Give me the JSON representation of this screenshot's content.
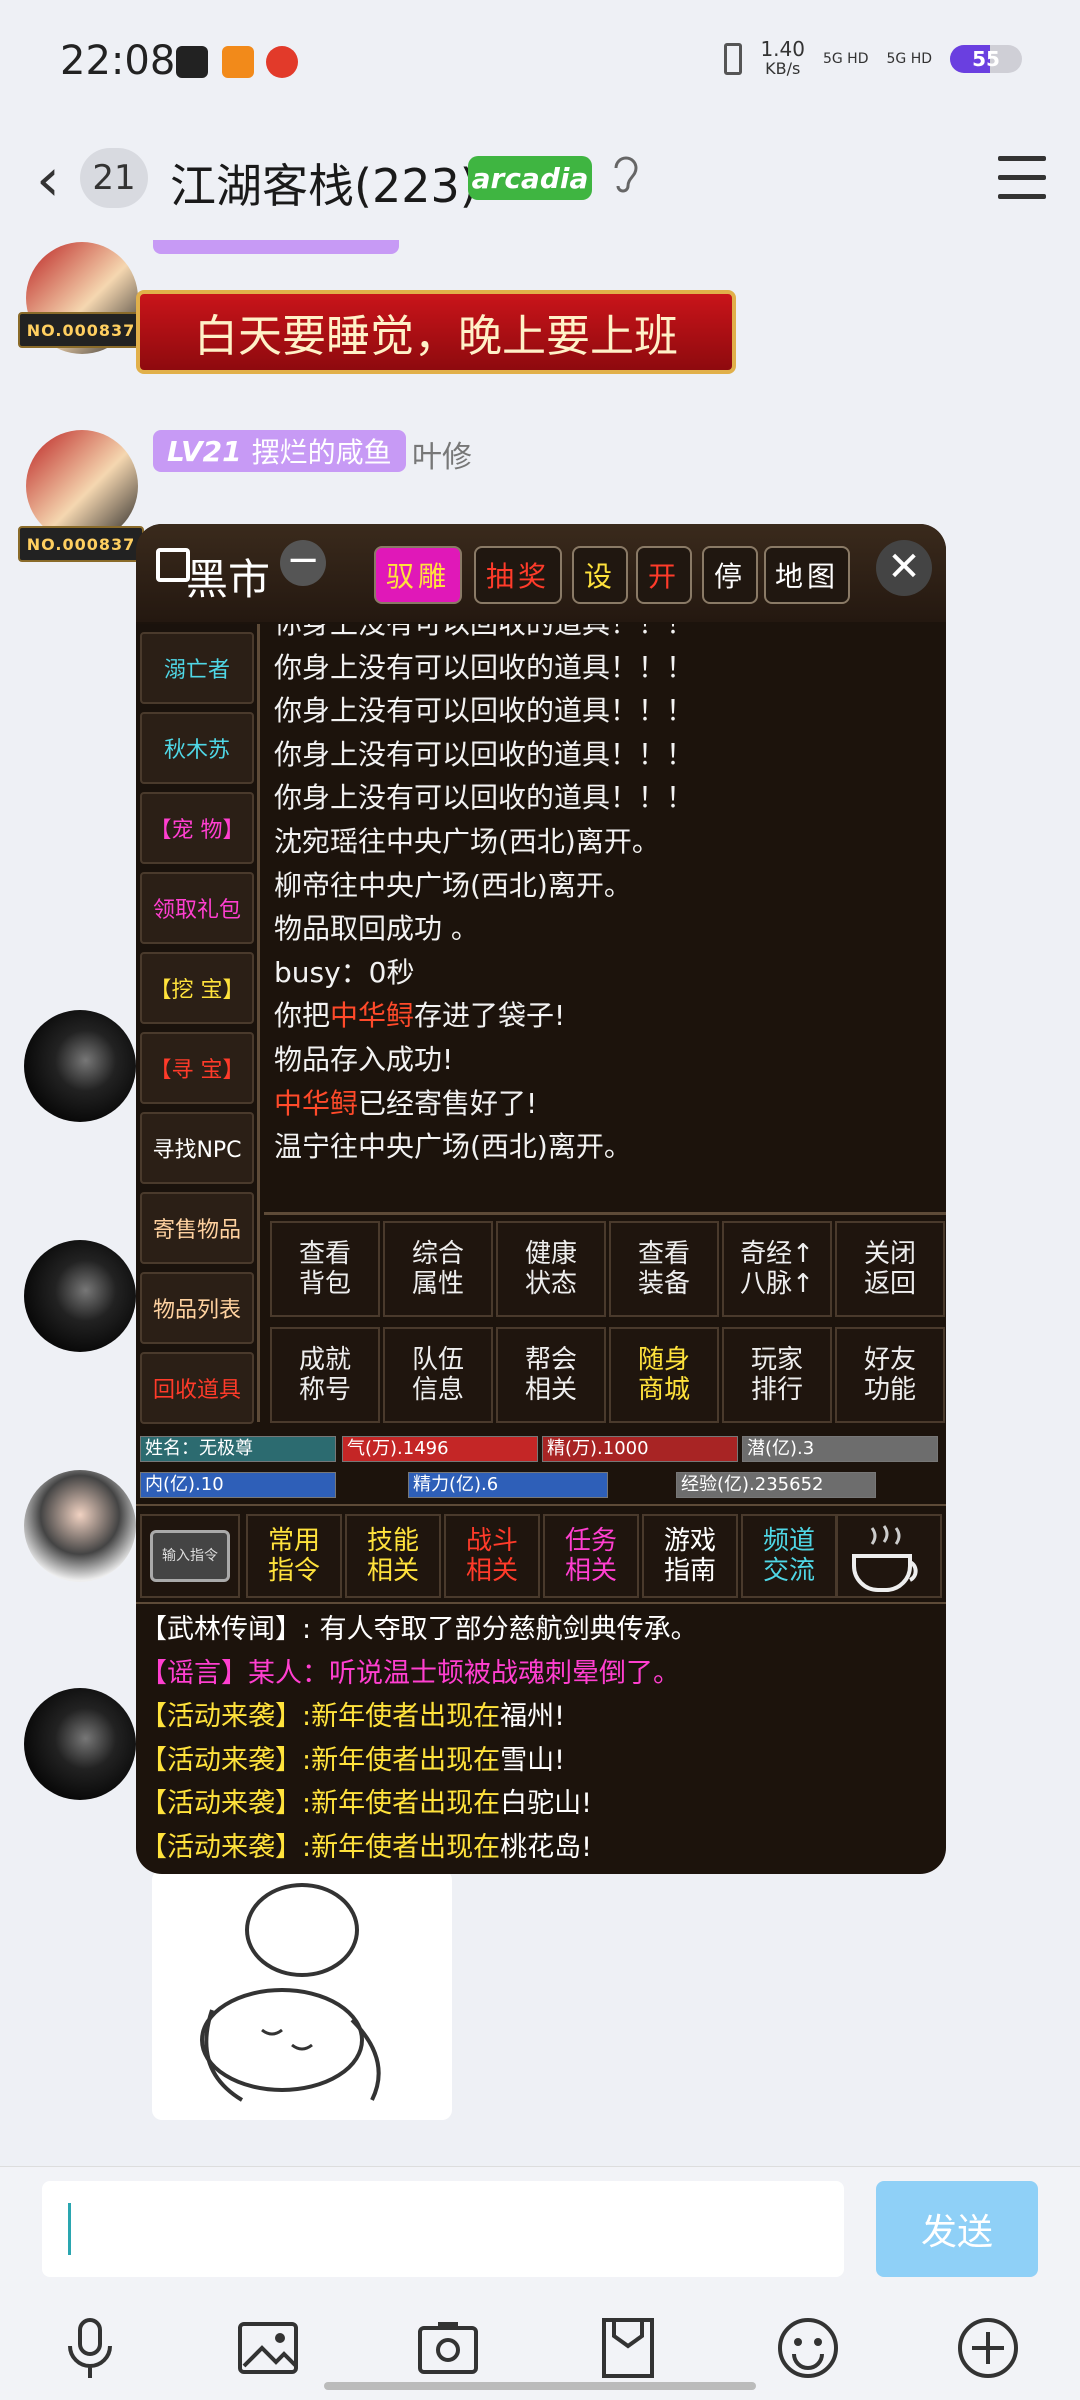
{
  "status": {
    "time": "22:08",
    "net_speed": "1.40",
    "net_unit": "KB/s",
    "sig1": "5G HD",
    "sig2": "5G HD",
    "battery": "55",
    "battery_level": 0.55
  },
  "header": {
    "unread": "21",
    "title": "江湖客栈(223)",
    "tag": "arcadia"
  },
  "chat": {
    "banner": "白天要睡觉，晚上要上班",
    "plate": "NO.000837",
    "lv": "LV21",
    "title_tag": "摆烂的咸鱼",
    "nick": "叶修"
  },
  "game": {
    "title": "黑市",
    "top_buttons": [
      {
        "label": "驭雕",
        "color": "#ffe23c",
        "bg": "#e018b8"
      },
      {
        "label": "抽奖",
        "color": "#ff3b2a",
        "bg": "#201710"
      },
      {
        "label": "设",
        "color": "#ffe23c",
        "bg": "#201710"
      },
      {
        "label": "开",
        "color": "#ff3b2a",
        "bg": "#201710"
      },
      {
        "label": "停",
        "color": "#ffffff",
        "bg": "#201710"
      },
      {
        "label": "地图",
        "color": "#ffffff",
        "bg": "#201710"
      }
    ],
    "side": [
      {
        "label": "溺亡者",
        "color": "#4fd7e6"
      },
      {
        "label": "秋木苏",
        "color": "#4fd7e6"
      },
      {
        "label": "【宠 物】",
        "color": "#ff3fd0"
      },
      {
        "label": "领取礼包",
        "color": "#ff3fd0"
      },
      {
        "label": "【挖 宝】",
        "color": "#ffe23c"
      },
      {
        "label": "【寻 宝】",
        "color": "#ff3b2a"
      },
      {
        "label": "寻找NPC",
        "color": "#ffffff"
      },
      {
        "label": "寄售物品",
        "color": "#ffd2a0"
      },
      {
        "label": "物品列表",
        "color": "#ffd2a0"
      },
      {
        "label": "回收道具",
        "color": "#ff3b2a"
      }
    ],
    "log": {
      "l1": "你身上没有可以回收的道具！！！",
      "l2": "你身上没有可以回收的道具！！！",
      "l3": "你身上没有可以回收的道具！！！",
      "l4": "你身上没有可以回收的道具！！！",
      "l5": "你身上没有可以回收的道具！！！",
      "l6": "沈宛瑶往中央广场(西北)离开。",
      "l7": "柳帝往中央广场(西北)离开。",
      "l8": "物品取回成功 。",
      "l9": "busy：0秒",
      "l10a": "你把",
      "l10b": "中华鲟",
      "l10c": "存进了袋子!",
      "l11": "物品存入成功!",
      "l12a": "中华鲟",
      "l12b": "已经寄售好了!",
      "l13": "温宁往中央广场(西北)离开。"
    },
    "grid": [
      {
        "label": "查看\n背包",
        "color": "#eeeeee"
      },
      {
        "label": "综合\n属性",
        "color": "#eeeeee"
      },
      {
        "label": "健康\n状态",
        "color": "#eeeeee"
      },
      {
        "label": "查看\n装备",
        "color": "#eeeeee"
      },
      {
        "label": "奇经↑\n八脉↑",
        "color": "#eeeeee"
      },
      {
        "label": "关闭\n返回",
        "color": "#eeeeee"
      },
      {
        "label": "成就\n称号",
        "color": "#eeeeee"
      },
      {
        "label": "队伍\n信息",
        "color": "#eeeeee"
      },
      {
        "label": "帮会\n相关",
        "color": "#eeeeee"
      },
      {
        "label": "随身\n商城",
        "color": "#ffe23c"
      },
      {
        "label": "玩家\n排行",
        "color": "#eeeeee"
      },
      {
        "label": "好友\n功能",
        "color": "#eeeeee"
      }
    ],
    "stats": {
      "name": "姓名：无极尊",
      "qi": "气(万).1496",
      "jing": "精(万).1000",
      "qian": "潜(亿).3",
      "nei": "内(亿).10",
      "jingli": "精力(亿).6",
      "exp": "经验(亿).235652"
    },
    "bottom": [
      {
        "label": "常用\n指令",
        "color": "#ffe23c"
      },
      {
        "label": "技能\n相关",
        "color": "#ffe23c"
      },
      {
        "label": "战斗\n相关",
        "color": "#ff3b2a"
      },
      {
        "label": "任务\n相关",
        "color": "#ff3fd0"
      },
      {
        "label": "游戏\n指南",
        "color": "#ffffff"
      },
      {
        "label": "频道\n交流",
        "color": "#4fd7e6"
      }
    ],
    "cmd_label": "输入指令",
    "news": {
      "n1": "【武林传闻】: 有人夺取了部分慈航剑典传承。",
      "n2": "【谣言】某人：听说温士顿被战魂刺晕倒了。",
      "n3a": "【活动来袭】:新年使者出现在",
      "n3b": "福州!",
      "n4a": "【活动来袭】:新年使者出现在",
      "n4b": "雪山!",
      "n5a": "【活动来袭】:新年使者出现在",
      "n5b": "白驼山!",
      "n6a": "【活动来袭】:新年使者出现在",
      "n6b": "桃花岛!"
    }
  },
  "input": {
    "send": "发送"
  },
  "tools": [
    "microphone-icon",
    "image-icon",
    "camera-icon",
    "folder-icon",
    "emoji-icon",
    "plus-icon"
  ]
}
